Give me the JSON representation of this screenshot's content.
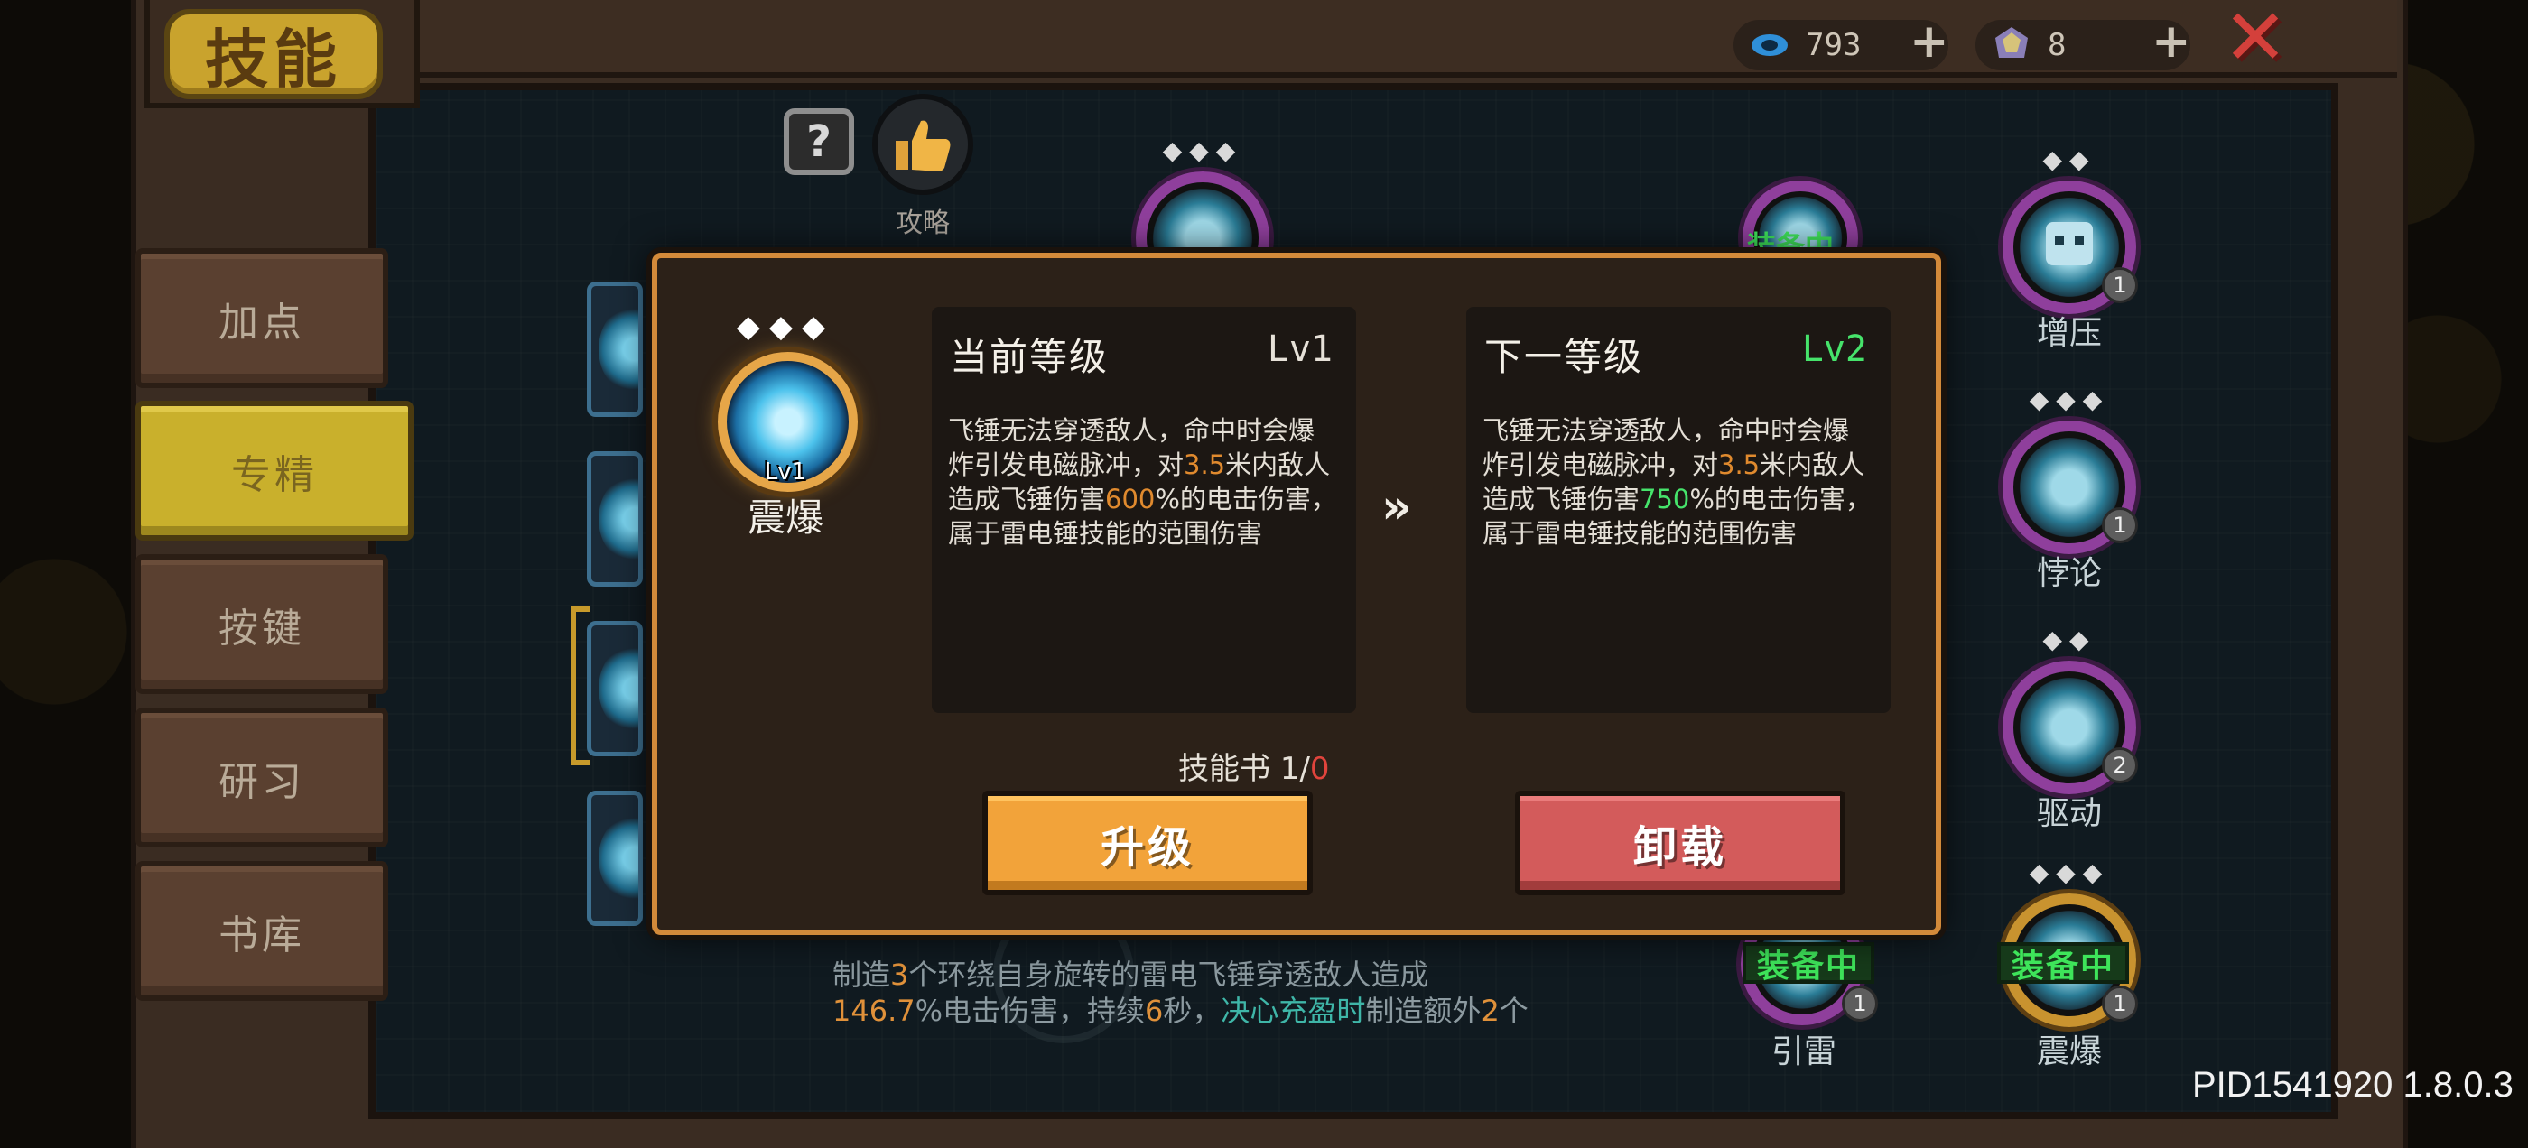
{
  "title": "技能",
  "currency": [
    {
      "name": "gem-currency",
      "value": "793",
      "icon": "blue-gem-icon"
    },
    {
      "name": "crystal-currency",
      "value": "8",
      "icon": "crystal-icon"
    }
  ],
  "plus_label": "+",
  "close_label": "✕",
  "tabs": [
    {
      "label": "加点",
      "active": false
    },
    {
      "label": "专精",
      "active": true
    },
    {
      "label": "按键",
      "active": false
    },
    {
      "label": "研习",
      "active": false
    },
    {
      "label": "书库",
      "active": false
    }
  ],
  "help_label": "?",
  "guide_label": "攻略",
  "nodes": {
    "pressure": {
      "label": "增压",
      "count": "1"
    },
    "paradox": {
      "label": "悖论",
      "count": "1"
    },
    "drive": {
      "label": "驱动",
      "count": "2"
    },
    "lead_thunder": {
      "label": "引雷",
      "count": "1",
      "equipped": "装备中"
    },
    "quake": {
      "label": "震爆",
      "count": "1",
      "equipped": "装备中"
    },
    "partial_equipped": "装备中"
  },
  "bottom_desc": {
    "p1": "制造",
    "n1": "3",
    "p2": "个环绕自身旋转的雷电飞锤穿透敌人造成",
    "n2": "146.7",
    "p3": "%电击伤害，持续",
    "n3": "6",
    "p4": "秒，",
    "t1": "决心充盈时",
    "p5": "制造额外",
    "n4": "2",
    "p6": "个"
  },
  "modal": {
    "skill_name": "震爆",
    "skill_level": "Lv1",
    "diamonds": "◆◆◆",
    "current": {
      "title": "当前等级",
      "level": "Lv1",
      "d1": "飞锤无法穿透敌人，命中时会爆炸引发电磁脉冲，对",
      "radius": "3.5",
      "d2": "米内敌人造成飞锤伤害",
      "damage": "600",
      "d3": "%的电击伤害，属于雷电锤技能的范围伤害"
    },
    "next": {
      "title": "下一等级",
      "level": "Lv2",
      "d1": "飞锤无法穿透敌人，命中时会爆炸引发电磁脉冲，对",
      "radius": "3.5",
      "d2": "米内敌人造成飞锤伤害",
      "damage": "750",
      "d3": "%的电击伤害，属于雷电锤技能的范围伤害"
    },
    "arrow": "»",
    "skillbook_label": "技能书",
    "skillbook_have": "1/",
    "skillbook_need": "0",
    "upgrade_label": "升级",
    "unequip_label": "卸载"
  },
  "version": "PID1541920 1.8.0.3",
  "colors": {
    "accent_gold": "#c9a32d",
    "equipped_green": "#3ee45a",
    "upgrade_orange": "#f2a33a",
    "unequip_red": "#d35b5b",
    "close_red": "#d4403b"
  }
}
